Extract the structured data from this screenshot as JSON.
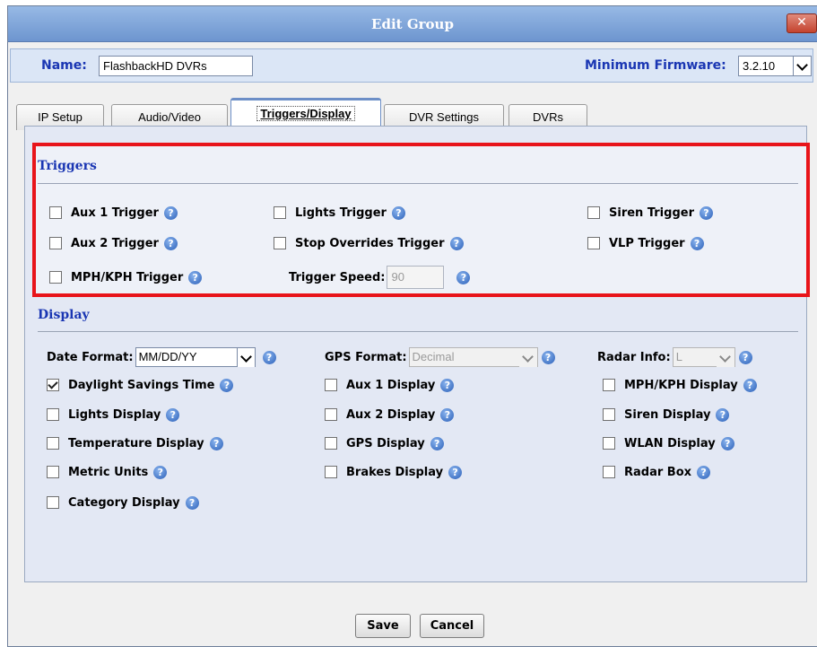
{
  "window": {
    "title": "Edit Group",
    "close_glyph": "✕"
  },
  "name_bar": {
    "name_label": "Name:",
    "name_value": "FlashbackHD DVRs",
    "firmware_label": "Minimum Firmware:",
    "firmware_value": "3.2.10"
  },
  "tabs": [
    {
      "label": "IP Setup",
      "active": false
    },
    {
      "label": "Audio/Video",
      "active": false
    },
    {
      "label": "Triggers/Display",
      "active": true
    },
    {
      "label": "DVR Settings",
      "active": false
    },
    {
      "label": "DVRs",
      "active": false
    }
  ],
  "triggers": {
    "title": "Triggers",
    "aux1": {
      "label": "Aux 1 Trigger",
      "checked": false
    },
    "lights": {
      "label": "Lights Trigger",
      "checked": false
    },
    "siren": {
      "label": "Siren Trigger",
      "checked": false
    },
    "aux2": {
      "label": "Aux 2 Trigger",
      "checked": false
    },
    "stop_overrides": {
      "label": "Stop Overrides Trigger",
      "checked": false
    },
    "vlp": {
      "label": "VLP Trigger",
      "checked": false
    },
    "mph_kph": {
      "label": "MPH/KPH Trigger",
      "checked": false
    },
    "speed_label": "Trigger Speed:",
    "speed_value": "90"
  },
  "display": {
    "title": "Display",
    "date_format_label": "Date Format:",
    "date_format_value": "MM/DD/YY",
    "gps_format_label": "GPS Format:",
    "gps_format_value": "Decimal",
    "radar_info_label": "Radar Info:",
    "radar_info_value": "L",
    "daylight": {
      "label": "Daylight Savings Time",
      "checked": true
    },
    "aux1_display": {
      "label": "Aux 1 Display",
      "checked": false
    },
    "mph_kph_display": {
      "label": "MPH/KPH Display",
      "checked": false
    },
    "lights_display": {
      "label": "Lights Display",
      "checked": false
    },
    "aux2_display": {
      "label": "Aux 2 Display",
      "checked": false
    },
    "siren_display": {
      "label": "Siren Display",
      "checked": false
    },
    "temperature_display": {
      "label": "Temperature Display",
      "checked": false
    },
    "gps_display": {
      "label": "GPS Display",
      "checked": false
    },
    "wlan_display": {
      "label": "WLAN Display",
      "checked": false
    },
    "metric_units": {
      "label": "Metric Units",
      "checked": false
    },
    "brakes_display": {
      "label": "Brakes Display",
      "checked": false
    },
    "radar_box": {
      "label": "Radar Box",
      "checked": false
    },
    "category_display": {
      "label": "Category Display",
      "checked": false
    }
  },
  "footer": {
    "save_label": "Save",
    "cancel_label": "Cancel"
  },
  "icons": {
    "help_glyph": "?",
    "help_color": "#2a5fb8",
    "highlight_color": "#e8141a"
  }
}
